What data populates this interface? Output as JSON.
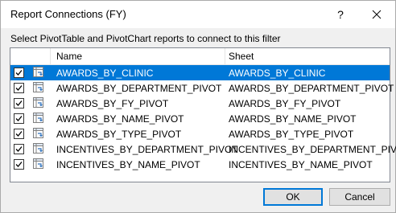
{
  "window": {
    "title": "Report Connections (FY)",
    "help_label": "?",
    "close_icon": "close-icon"
  },
  "instruction": "Select PivotTable and PivotChart reports to connect to this filter",
  "columns": {
    "name": "Name",
    "sheet": "Sheet"
  },
  "rows": [
    {
      "name": "AWARDS_BY_CLINIC",
      "sheet": "AWARDS_BY_CLINIC",
      "checked": true,
      "selected": true
    },
    {
      "name": "AWARDS_BY_DEPARTMENT_PIVOT",
      "sheet": "AWARDS_BY_DEPARTMENT_PIVOT",
      "checked": true,
      "selected": false
    },
    {
      "name": "AWARDS_BY_FY_PIVOT",
      "sheet": "AWARDS_BY_FY_PIVOT",
      "checked": true,
      "selected": false
    },
    {
      "name": "AWARDS_BY_NAME_PIVOT",
      "sheet": "AWARDS_BY_NAME_PIVOT",
      "checked": true,
      "selected": false
    },
    {
      "name": "AWARDS_BY_TYPE_PIVOT",
      "sheet": "AWARDS_BY_TYPE_PIVOT",
      "checked": true,
      "selected": false
    },
    {
      "name": "INCENTIVES_BY_DEPARTMENT_PIVOT",
      "sheet": "INCENTIVES_BY_DEPARTMENT_PIVOT",
      "checked": true,
      "selected": false
    },
    {
      "name": "INCENTIVES_BY_NAME_PIVOT",
      "sheet": "INCENTIVES_BY_NAME_PIVOT",
      "checked": true,
      "selected": false
    }
  ],
  "buttons": {
    "ok": "OK",
    "cancel": "Cancel"
  },
  "colors": {
    "selection": "#0078d7",
    "accent": "#0078d7"
  }
}
